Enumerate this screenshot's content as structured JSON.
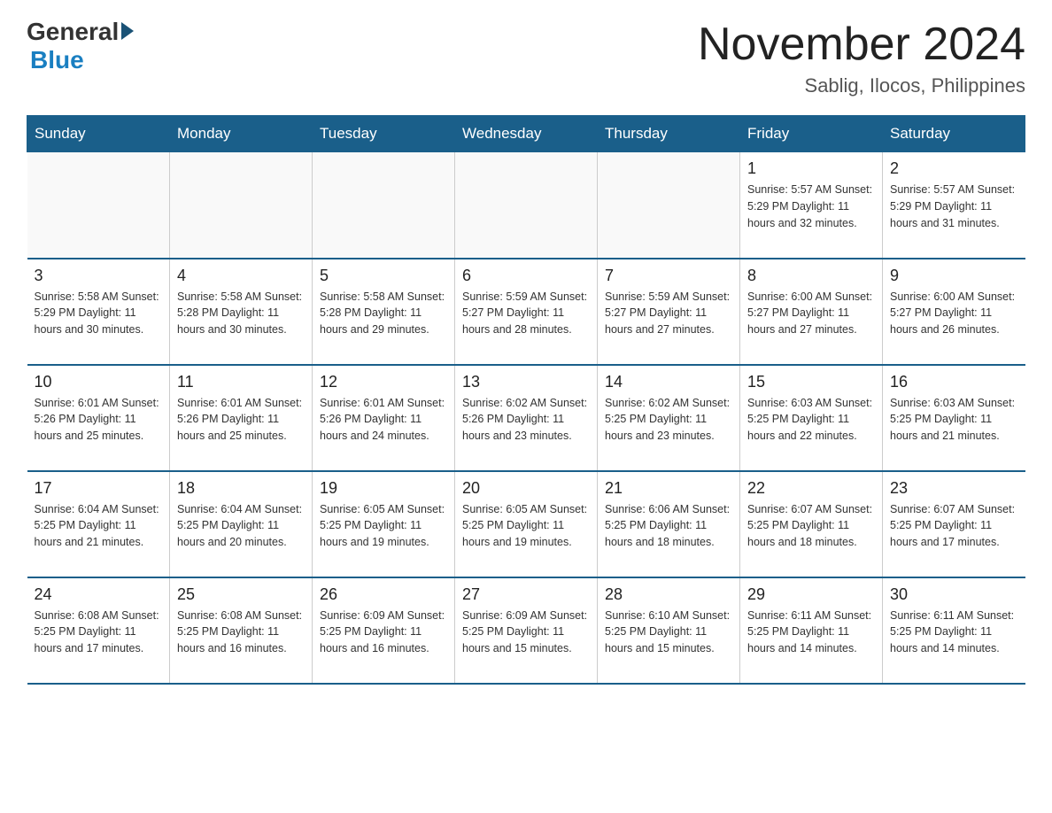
{
  "logo": {
    "general": "General",
    "blue": "Blue"
  },
  "title": {
    "month_year": "November 2024",
    "location": "Sablig, Ilocos, Philippines"
  },
  "days_of_week": [
    "Sunday",
    "Monday",
    "Tuesday",
    "Wednesday",
    "Thursday",
    "Friday",
    "Saturday"
  ],
  "weeks": [
    [
      {
        "day": "",
        "info": ""
      },
      {
        "day": "",
        "info": ""
      },
      {
        "day": "",
        "info": ""
      },
      {
        "day": "",
        "info": ""
      },
      {
        "day": "",
        "info": ""
      },
      {
        "day": "1",
        "info": "Sunrise: 5:57 AM\nSunset: 5:29 PM\nDaylight: 11 hours and 32 minutes."
      },
      {
        "day": "2",
        "info": "Sunrise: 5:57 AM\nSunset: 5:29 PM\nDaylight: 11 hours and 31 minutes."
      }
    ],
    [
      {
        "day": "3",
        "info": "Sunrise: 5:58 AM\nSunset: 5:29 PM\nDaylight: 11 hours and 30 minutes."
      },
      {
        "day": "4",
        "info": "Sunrise: 5:58 AM\nSunset: 5:28 PM\nDaylight: 11 hours and 30 minutes."
      },
      {
        "day": "5",
        "info": "Sunrise: 5:58 AM\nSunset: 5:28 PM\nDaylight: 11 hours and 29 minutes."
      },
      {
        "day": "6",
        "info": "Sunrise: 5:59 AM\nSunset: 5:27 PM\nDaylight: 11 hours and 28 minutes."
      },
      {
        "day": "7",
        "info": "Sunrise: 5:59 AM\nSunset: 5:27 PM\nDaylight: 11 hours and 27 minutes."
      },
      {
        "day": "8",
        "info": "Sunrise: 6:00 AM\nSunset: 5:27 PM\nDaylight: 11 hours and 27 minutes."
      },
      {
        "day": "9",
        "info": "Sunrise: 6:00 AM\nSunset: 5:27 PM\nDaylight: 11 hours and 26 minutes."
      }
    ],
    [
      {
        "day": "10",
        "info": "Sunrise: 6:01 AM\nSunset: 5:26 PM\nDaylight: 11 hours and 25 minutes."
      },
      {
        "day": "11",
        "info": "Sunrise: 6:01 AM\nSunset: 5:26 PM\nDaylight: 11 hours and 25 minutes."
      },
      {
        "day": "12",
        "info": "Sunrise: 6:01 AM\nSunset: 5:26 PM\nDaylight: 11 hours and 24 minutes."
      },
      {
        "day": "13",
        "info": "Sunrise: 6:02 AM\nSunset: 5:26 PM\nDaylight: 11 hours and 23 minutes."
      },
      {
        "day": "14",
        "info": "Sunrise: 6:02 AM\nSunset: 5:25 PM\nDaylight: 11 hours and 23 minutes."
      },
      {
        "day": "15",
        "info": "Sunrise: 6:03 AM\nSunset: 5:25 PM\nDaylight: 11 hours and 22 minutes."
      },
      {
        "day": "16",
        "info": "Sunrise: 6:03 AM\nSunset: 5:25 PM\nDaylight: 11 hours and 21 minutes."
      }
    ],
    [
      {
        "day": "17",
        "info": "Sunrise: 6:04 AM\nSunset: 5:25 PM\nDaylight: 11 hours and 21 minutes."
      },
      {
        "day": "18",
        "info": "Sunrise: 6:04 AM\nSunset: 5:25 PM\nDaylight: 11 hours and 20 minutes."
      },
      {
        "day": "19",
        "info": "Sunrise: 6:05 AM\nSunset: 5:25 PM\nDaylight: 11 hours and 19 minutes."
      },
      {
        "day": "20",
        "info": "Sunrise: 6:05 AM\nSunset: 5:25 PM\nDaylight: 11 hours and 19 minutes."
      },
      {
        "day": "21",
        "info": "Sunrise: 6:06 AM\nSunset: 5:25 PM\nDaylight: 11 hours and 18 minutes."
      },
      {
        "day": "22",
        "info": "Sunrise: 6:07 AM\nSunset: 5:25 PM\nDaylight: 11 hours and 18 minutes."
      },
      {
        "day": "23",
        "info": "Sunrise: 6:07 AM\nSunset: 5:25 PM\nDaylight: 11 hours and 17 minutes."
      }
    ],
    [
      {
        "day": "24",
        "info": "Sunrise: 6:08 AM\nSunset: 5:25 PM\nDaylight: 11 hours and 17 minutes."
      },
      {
        "day": "25",
        "info": "Sunrise: 6:08 AM\nSunset: 5:25 PM\nDaylight: 11 hours and 16 minutes."
      },
      {
        "day": "26",
        "info": "Sunrise: 6:09 AM\nSunset: 5:25 PM\nDaylight: 11 hours and 16 minutes."
      },
      {
        "day": "27",
        "info": "Sunrise: 6:09 AM\nSunset: 5:25 PM\nDaylight: 11 hours and 15 minutes."
      },
      {
        "day": "28",
        "info": "Sunrise: 6:10 AM\nSunset: 5:25 PM\nDaylight: 11 hours and 15 minutes."
      },
      {
        "day": "29",
        "info": "Sunrise: 6:11 AM\nSunset: 5:25 PM\nDaylight: 11 hours and 14 minutes."
      },
      {
        "day": "30",
        "info": "Sunrise: 6:11 AM\nSunset: 5:25 PM\nDaylight: 11 hours and 14 minutes."
      }
    ]
  ]
}
